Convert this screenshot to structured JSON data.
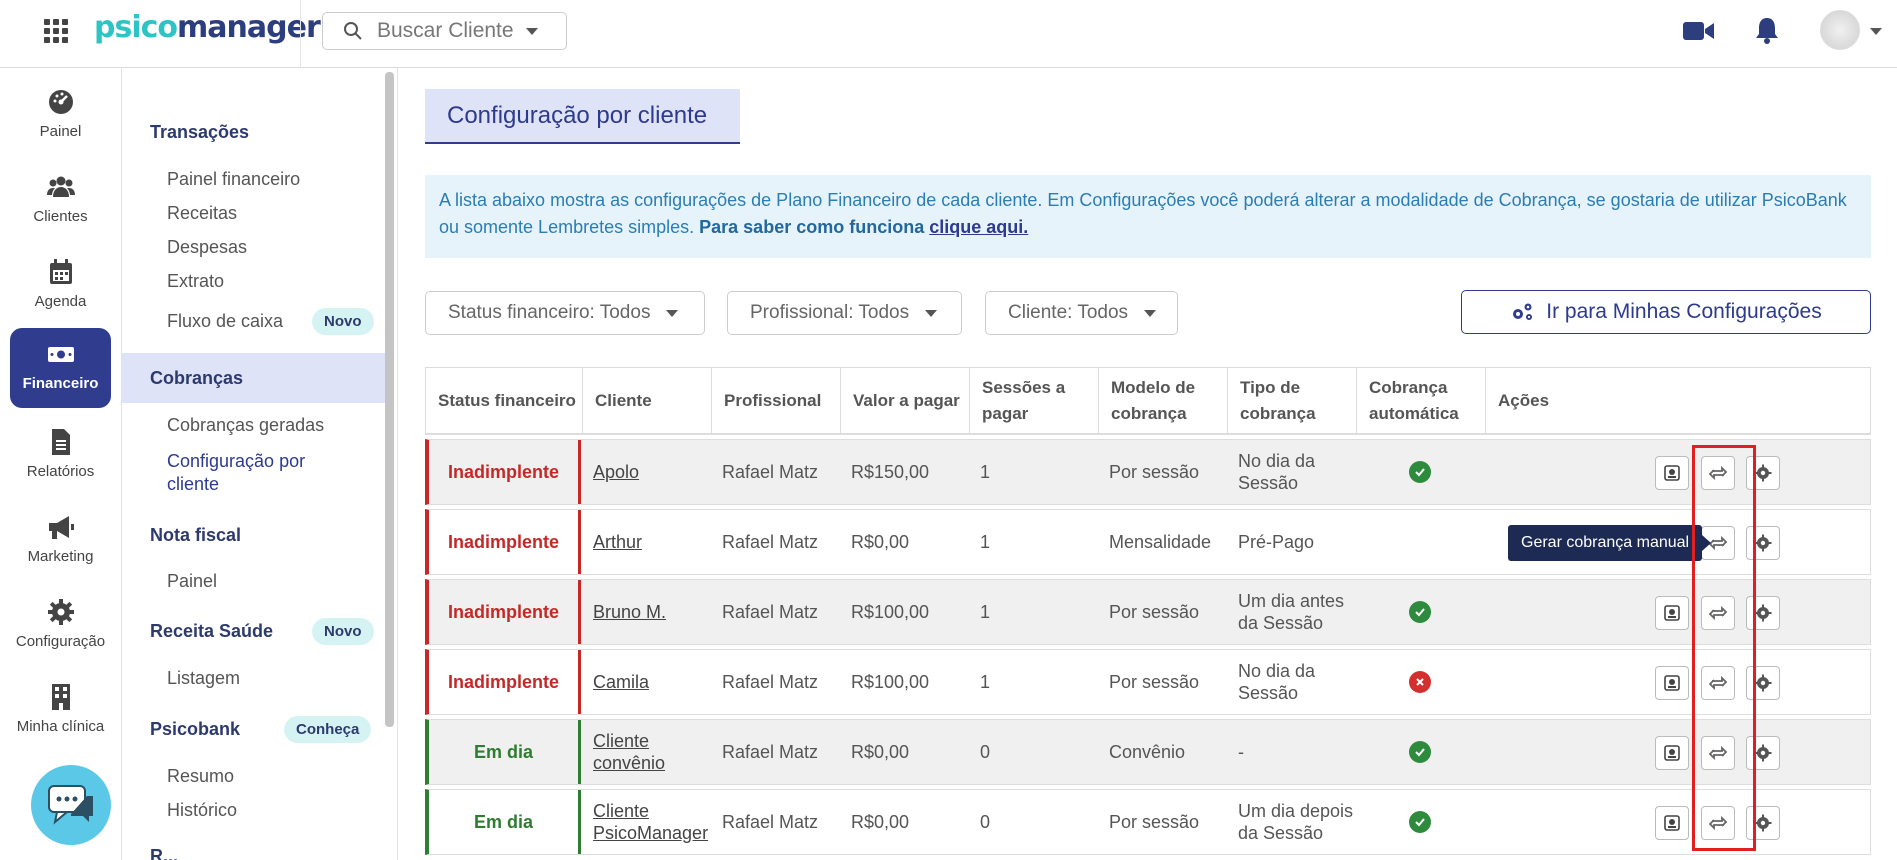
{
  "app": {
    "logo_part1": "psico",
    "logo_part2": "manager"
  },
  "topbar": {
    "search_label": "Buscar Cliente"
  },
  "rail": [
    {
      "label": "Painel",
      "icon": "dashboard-icon"
    },
    {
      "label": "Clientes",
      "icon": "users-icon"
    },
    {
      "label": "Agenda",
      "icon": "calendar-icon"
    },
    {
      "label": "Financeiro",
      "icon": "money-icon"
    },
    {
      "label": "Relatórios",
      "icon": "document-icon"
    },
    {
      "label": "Marketing",
      "icon": "megaphone-icon"
    },
    {
      "label": "Configuração",
      "icon": "gear-icon"
    },
    {
      "label": "Minha clínica",
      "icon": "building-icon"
    }
  ],
  "subnav": {
    "transacoes": "Transações",
    "painel_financeiro": "Painel financeiro",
    "receitas": "Receitas",
    "despesas": "Despesas",
    "extrato": "Extrato",
    "fluxo_caixa": "Fluxo de caixa",
    "novo1": "Novo",
    "cobrancas": "Cobranças",
    "cobrancas_geradas": "Cobranças geradas",
    "config_cliente": "Configuração por cliente",
    "nota_fiscal": "Nota fiscal",
    "painel": "Painel",
    "receita_saude": "Receita Saúde",
    "novo2": "Novo",
    "listagem": "Listagem",
    "psicobank": "Psicobank",
    "conheca": "Conheça",
    "resumo": "Resumo",
    "historico": "Histórico",
    "cut_item": "R..."
  },
  "main": {
    "title": "Configuração por cliente",
    "info_text": "A lista abaixo mostra as configurações de Plano Financeiro de cada cliente. Em Configurações você poderá alterar a modalidade de Cobrança, se gostaria de utilizar PsicoBank ou somente Lembretes simples.",
    "info_bold": "Para saber como funciona",
    "info_link": "clique aqui.",
    "filter_status": "Status financeiro: Todos",
    "filter_prof": "Profissional: Todos",
    "filter_cliente": "Cliente: Todos",
    "config_button": "Ir para Minhas Configurações",
    "tooltip": "Gerar cobrança manual"
  },
  "table": {
    "headers": [
      "Status financeiro",
      "Cliente",
      "Profissional",
      "Valor a pagar",
      "Sessões a pagar",
      "Modelo de cobrança",
      "Tipo de cobrança",
      "Cobrança automática",
      "Ações"
    ],
    "rows": [
      {
        "status": "Inadimplente",
        "client": "Apolo",
        "prof": "Rafael Matz",
        "value": "R$150,00",
        "sessions": "1",
        "model": "Por sessão",
        "type": "No dia da Sessão",
        "auto": true
      },
      {
        "status": "Inadimplente",
        "client": "Arthur",
        "prof": "Rafael Matz",
        "value": "R$0,00",
        "sessions": "1",
        "model": "Mensalidade",
        "type": "Pré-Pago",
        "auto": null
      },
      {
        "status": "Inadimplente",
        "client": "Bruno M.",
        "prof": "Rafael Matz",
        "value": "R$100,00",
        "sessions": "1",
        "model": "Por sessão",
        "type": "Um dia antes da Sessão",
        "auto": true
      },
      {
        "status": "Inadimplente",
        "client": "Camila",
        "prof": "Rafael Matz",
        "value": "R$100,00",
        "sessions": "1",
        "model": "Por sessão",
        "type": "No dia da Sessão",
        "auto": false
      },
      {
        "status": "Em dia",
        "client": "Cliente convênio",
        "prof": "Rafael Matz",
        "value": "R$0,00",
        "sessions": "0",
        "model": "Convênio",
        "type": "-",
        "auto": true
      },
      {
        "status": "Em dia",
        "client": "Cliente PsicoManager",
        "prof": "Rafael Matz",
        "value": "R$0,00",
        "sessions": "0",
        "model": "Por sessão",
        "type": "Um dia depois da Sessão",
        "auto": true
      }
    ]
  },
  "colors": {
    "primary": "#303d8f",
    "accent": "#2ec4c6",
    "danger": "#c62828",
    "success": "#2e7d32"
  }
}
